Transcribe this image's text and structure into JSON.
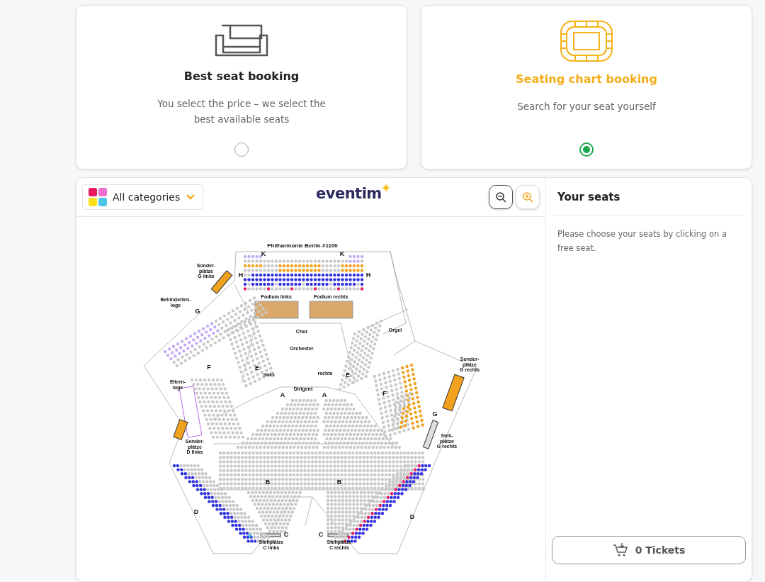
{
  "booking_options": [
    {
      "kind": "armchair",
      "title": "Best seat booking",
      "description": "You select the price – we select the best available seats",
      "selected": false
    },
    {
      "kind": "seating-chart",
      "title": "Seating chart booking",
      "description": "Search for your seat yourself",
      "selected": true
    }
  ],
  "toolbar": {
    "category_filter": "All categories",
    "logo": "eventim"
  },
  "seat_map": {
    "labels": [
      {
        "lines": [
          "Philharmonie Berlin   #1100"
        ]
      },
      {
        "lines": [
          "K"
        ]
      },
      {
        "lines": [
          "K"
        ]
      },
      {
        "lines": [
          "Sonder-",
          "plätze",
          "G links"
        ]
      },
      {
        "lines": [
          "H"
        ]
      },
      {
        "lines": [
          "H"
        ]
      },
      {
        "lines": [
          "Behinderten-",
          "loge"
        ]
      },
      {
        "lines": [
          "G"
        ]
      },
      {
        "lines": [
          "Podium links"
        ]
      },
      {
        "lines": [
          "Podium rechts"
        ]
      },
      {
        "lines": [
          "Chor"
        ]
      },
      {
        "lines": [
          "Orchester"
        ]
      },
      {
        "lines": [
          "Orgel"
        ]
      },
      {
        "lines": [
          "E"
        ]
      },
      {
        "lines": [
          "E"
        ]
      },
      {
        "lines": [
          "F"
        ]
      },
      {
        "lines": [
          "F"
        ]
      },
      {
        "lines": [
          "links"
        ]
      },
      {
        "lines": [
          "rechts"
        ]
      },
      {
        "lines": [
          "Dirigent"
        ]
      },
      {
        "lines": [
          "A"
        ]
      },
      {
        "lines": [
          "A"
        ]
      },
      {
        "lines": [
          "Sonder-",
          "plätze",
          "G rechts"
        ]
      },
      {
        "lines": [
          "Eltern-",
          "loge"
        ]
      },
      {
        "lines": [
          "G"
        ]
      },
      {
        "lines": [
          "Steh-",
          "plätze",
          "G rechts"
        ]
      },
      {
        "lines": [
          "Sonder-",
          "plätze",
          "D links"
        ]
      },
      {
        "lines": [
          "B"
        ]
      },
      {
        "lines": [
          "B"
        ]
      },
      {
        "lines": [
          "D"
        ]
      },
      {
        "lines": [
          "D"
        ]
      },
      {
        "lines": [
          "C"
        ]
      },
      {
        "lines": [
          "C"
        ]
      },
      {
        "lines": [
          "Stehplätze",
          "C links"
        ]
      },
      {
        "lines": [
          "Stehplätze",
          "C rechts"
        ]
      }
    ]
  },
  "sidebar": {
    "title": "Your seats",
    "message": "Please choose your seats by clicking on a free seat.",
    "tickets_button": "0 Tickets"
  }
}
